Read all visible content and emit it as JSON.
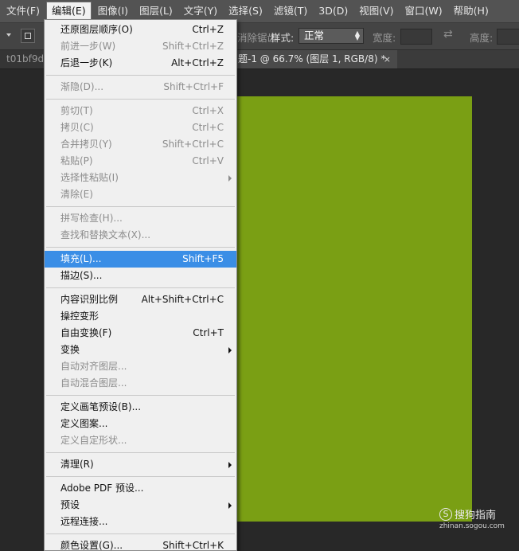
{
  "menubar": [
    {
      "label": "文件(F)",
      "active": false
    },
    {
      "label": "编辑(E)",
      "active": true
    },
    {
      "label": "图像(I)",
      "active": false
    },
    {
      "label": "图层(L)",
      "active": false
    },
    {
      "label": "文字(Y)",
      "active": false
    },
    {
      "label": "选择(S)",
      "active": false
    },
    {
      "label": "滤镜(T)",
      "active": false
    },
    {
      "label": "3D(D)",
      "active": false
    },
    {
      "label": "视图(V)",
      "active": false
    },
    {
      "label": "窗口(W)",
      "active": false
    },
    {
      "label": "帮助(H)",
      "active": false
    }
  ],
  "options": {
    "antialias_fragment": "消除锯齿",
    "style_label": "样式:",
    "style_value": "正常",
    "width_label": "宽度:",
    "height_label": "高度:"
  },
  "tabs": {
    "inactive": "t01bf9d",
    "active": "题-1 @ 66.7% (图层 1, RGB/8) *",
    "close": "×"
  },
  "canvas": {
    "fill_color": "#7a9f14"
  },
  "edit_menu": [
    {
      "label": "还原图层顺序(O)",
      "shortcut": "Ctrl+Z",
      "disabled": false
    },
    {
      "label": "前进一步(W)",
      "shortcut": "Shift+Ctrl+Z",
      "disabled": true
    },
    {
      "label": "后退一步(K)",
      "shortcut": "Alt+Ctrl+Z",
      "disabled": false
    },
    {
      "sep": true
    },
    {
      "label": "渐隐(D)...",
      "shortcut": "Shift+Ctrl+F",
      "disabled": true
    },
    {
      "sep": true
    },
    {
      "label": "剪切(T)",
      "shortcut": "Ctrl+X",
      "disabled": true
    },
    {
      "label": "拷贝(C)",
      "shortcut": "Ctrl+C",
      "disabled": true
    },
    {
      "label": "合并拷贝(Y)",
      "shortcut": "Shift+Ctrl+C",
      "disabled": true
    },
    {
      "label": "粘贴(P)",
      "shortcut": "Ctrl+V",
      "disabled": true
    },
    {
      "label": "选择性粘贴(I)",
      "submenu": true,
      "disabled": true
    },
    {
      "label": "清除(E)",
      "disabled": true
    },
    {
      "sep": true
    },
    {
      "label": "拼写检查(H)...",
      "disabled": true
    },
    {
      "label": "查找和替换文本(X)...",
      "disabled": true
    },
    {
      "sep": true
    },
    {
      "label": "填充(L)...",
      "shortcut": "Shift+F5",
      "disabled": false,
      "highlighted": true
    },
    {
      "label": "描边(S)...",
      "disabled": false
    },
    {
      "sep": true
    },
    {
      "label": "内容识别比例",
      "shortcut": "Alt+Shift+Ctrl+C",
      "disabled": false
    },
    {
      "label": "操控变形",
      "disabled": false
    },
    {
      "label": "自由变换(F)",
      "shortcut": "Ctrl+T",
      "disabled": false
    },
    {
      "label": "变换",
      "submenu": true,
      "disabled": false
    },
    {
      "label": "自动对齐图层...",
      "disabled": true
    },
    {
      "label": "自动混合图层...",
      "disabled": true
    },
    {
      "sep": true
    },
    {
      "label": "定义画笔预设(B)...",
      "disabled": false
    },
    {
      "label": "定义图案...",
      "disabled": false
    },
    {
      "label": "定义自定形状...",
      "disabled": true
    },
    {
      "sep": true
    },
    {
      "label": "清理(R)",
      "submenu": true,
      "disabled": false
    },
    {
      "sep": true
    },
    {
      "label": "Adobe PDF 预设...",
      "disabled": false
    },
    {
      "label": "预设",
      "submenu": true,
      "disabled": false
    },
    {
      "label": "远程连接...",
      "disabled": false
    },
    {
      "sep": true
    },
    {
      "label": "颜色设置(G)...",
      "shortcut": "Shift+Ctrl+K",
      "disabled": false
    }
  ],
  "watermark": {
    "symbol": "S",
    "text": "搜狗指南",
    "url": "zhinan.sogou.com"
  }
}
